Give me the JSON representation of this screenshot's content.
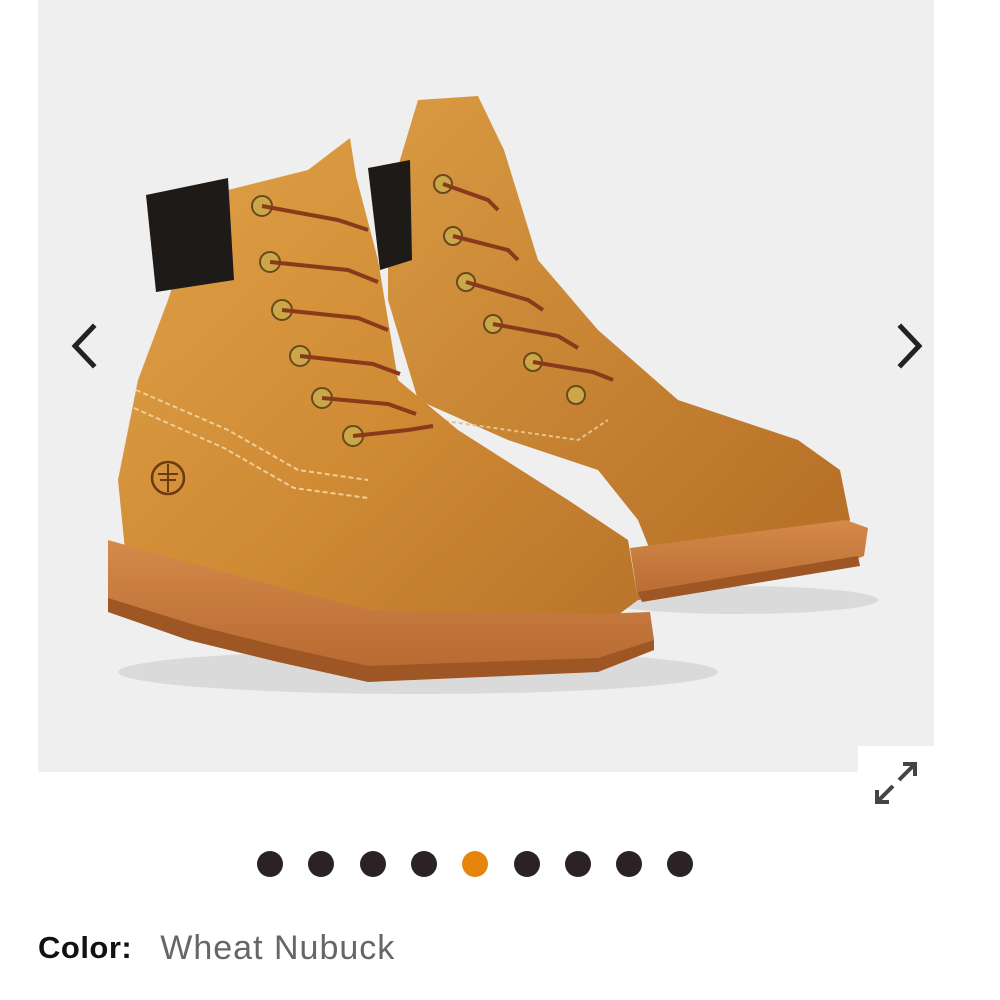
{
  "gallery": {
    "image_alt": "Wheat Nubuck 6-inch boots",
    "prev_icon": "chevron-left-icon",
    "next_icon": "chevron-right-icon",
    "expand_icon": "expand-arrows-icon",
    "slide_count": 9,
    "active_slide": 5,
    "accent_color": "#e6850c",
    "dot_color": "#2b2226"
  },
  "color": {
    "label": "Color:",
    "value": "Wheat Nubuck"
  }
}
